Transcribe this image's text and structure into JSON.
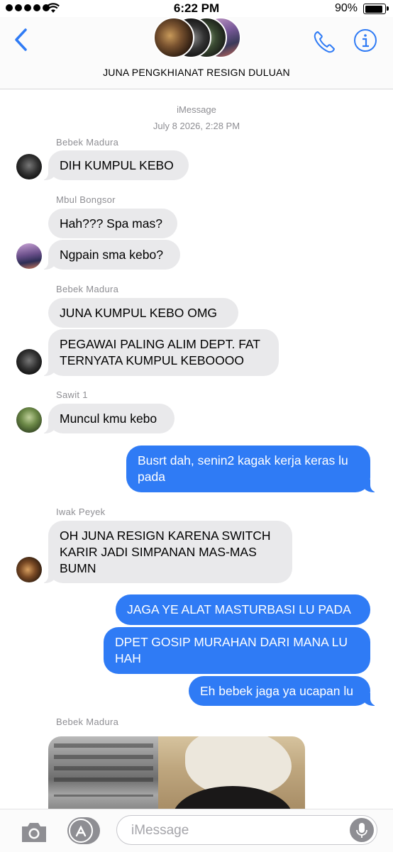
{
  "status_bar": {
    "time": "6:22 PM",
    "battery": "90%"
  },
  "header": {
    "group_name": "JUNA PENGKHIANAT RESIGN DULUAN",
    "icons": {
      "back": "chevron-left-icon",
      "call": "phone-icon",
      "info": "info-icon"
    }
  },
  "chat": {
    "service": "iMessage",
    "timestamp": "July 8 2026, 2:28 PM",
    "senders": {
      "bebek1": "Bebek Madura",
      "mbul": "Mbul Bongsor",
      "bebek2": "Bebek Madura",
      "sawit": "Sawit 1",
      "iwak": "Iwak Peyek",
      "bebek3": "Bebek Madura"
    },
    "messages": {
      "m1": "DIH KUMPUL KEBO",
      "m2": "Hah??? Spa mas?",
      "m3": "Ngpain sma kebo?",
      "m4": "JUNA KUMPUL KEBO OMG",
      "m5": "PEGAWAI PALING ALIM DEPT. FAT TERNYATA KUMPUL KEBOOOO",
      "m6": "Muncul kmu kebo",
      "m7": "Busrt dah, senin2 kagak kerja keras lu pada",
      "m8": "OH JUNA RESIGN KARENA SWITCH KARIR JADI SIMPANAN MAS-MAS BUMN",
      "m9": "JAGA YE ALAT MASTURBASI LU PADA",
      "m10": "DPET GOSIP MURAHAN DARI MANA LU HAH",
      "m11": "Eh bebek jaga ya ucapan lu"
    },
    "colors": {
      "incoming": "#e9e9eb",
      "outgoing": "#2f7bf5"
    }
  },
  "input_bar": {
    "placeholder": "iMessage",
    "icons": {
      "camera": "camera-icon",
      "apps": "app-store-icon",
      "mic": "microphone-icon"
    }
  }
}
